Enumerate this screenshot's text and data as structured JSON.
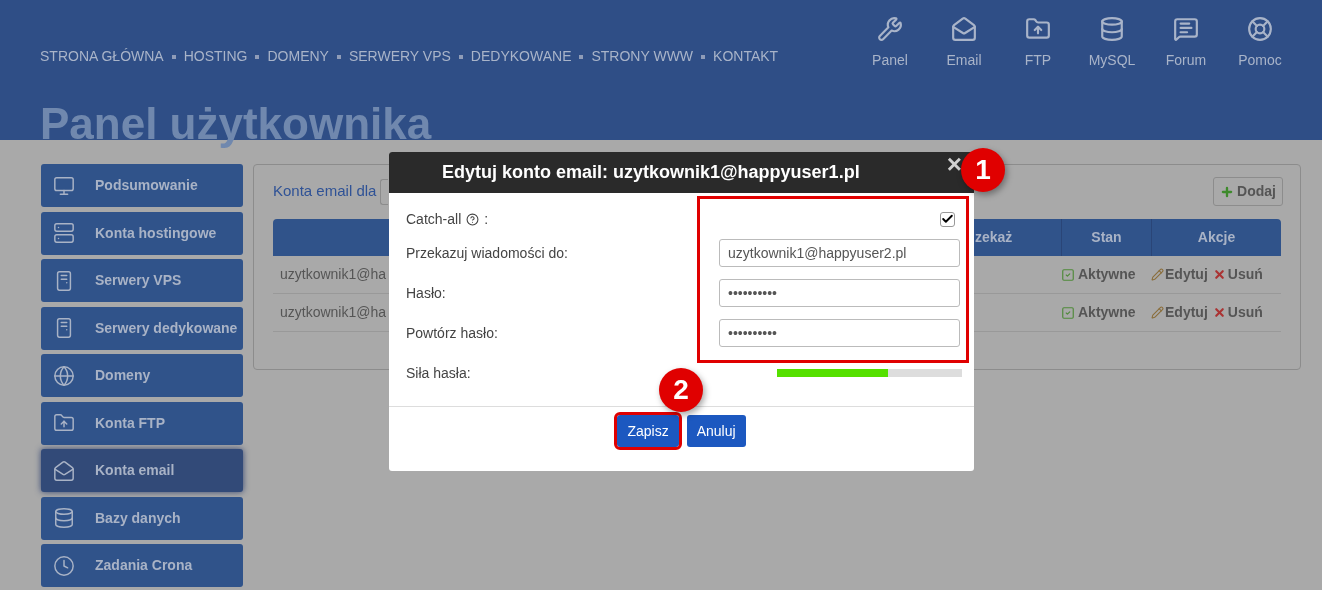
{
  "nav": {
    "links": [
      "STRONA GŁÓWNA",
      "HOSTING",
      "DOMENY",
      "SERWERY VPS",
      "DEDYKOWANE",
      "STRONY WWW",
      "KONTAKT"
    ],
    "shortcuts": [
      "Panel",
      "Email",
      "FTP",
      "MySQL",
      "Forum",
      "Pomoc"
    ]
  },
  "page_title": "Panel użytkownika",
  "sidebar": {
    "items": [
      {
        "label": "Podsumowanie",
        "selected": false
      },
      {
        "label": "Konta hostingowe",
        "selected": false
      },
      {
        "label": "Serwery VPS",
        "selected": false
      },
      {
        "label": "Serwery dedykowane",
        "selected": false
      },
      {
        "label": "Domeny",
        "selected": false
      },
      {
        "label": "Konta FTP",
        "selected": false
      },
      {
        "label": "Konta email",
        "selected": true
      },
      {
        "label": "Bazy danych",
        "selected": false
      },
      {
        "label": "Zadania Crona",
        "selected": false
      }
    ]
  },
  "panel": {
    "heading": "Konta email dla",
    "add_button": "Dodaj",
    "table": {
      "columns": [
        "zekaż",
        "Stan",
        "Akcje"
      ],
      "rows": [
        {
          "email": "uzytkownik1@ha",
          "status": "Aktywne",
          "edit": "Edytuj",
          "delete": "Usuń"
        },
        {
          "email": "uzytkownik1@ha",
          "status": "Aktywne",
          "edit": "Edytuj",
          "delete": "Usuń"
        }
      ]
    }
  },
  "dialog": {
    "title": "Edytuj konto email: uzytkownik1@happyuser1.pl",
    "close": "×",
    "catch_all": {
      "label": "Catch-all",
      "suffix": ":",
      "checked": true
    },
    "fields": [
      {
        "label": "Przekazuj wiadomości do:",
        "value": "uzytkownik1@happyuser2.pl"
      },
      {
        "label": "Hasło:",
        "value": "••••••••••"
      },
      {
        "label": "Powtórz hasło:",
        "value": "••••••••••"
      }
    ],
    "strength": {
      "label": "Siła hasła:",
      "level": 0.6
    },
    "buttons": [
      "Zapisz",
      "Anuluj"
    ]
  },
  "annotations": [
    "1",
    "2"
  ]
}
